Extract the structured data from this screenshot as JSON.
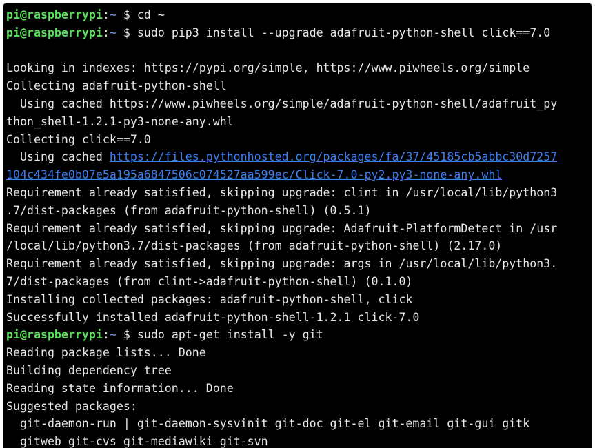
{
  "terminal": {
    "lines": [
      {
        "type": "prompt",
        "user": "pi@raspberrypi",
        "sep": ":",
        "path": "~",
        "symbol": "$",
        "command": "cd ~"
      },
      {
        "type": "prompt",
        "user": "pi@raspberrypi",
        "sep": ":",
        "path": "~",
        "symbol": "$",
        "command": "sudo pip3 install --upgrade adafruit-python-shell click==7.0"
      },
      {
        "type": "output",
        "text": ""
      },
      {
        "type": "output",
        "text": "Looking in indexes: https://pypi.org/simple, https://www.piwheels.org/simple"
      },
      {
        "type": "output",
        "text": "Collecting adafruit-python-shell"
      },
      {
        "type": "output",
        "text": "  Using cached https://www.piwheels.org/simple/adafruit-python-shell/adafruit_py"
      },
      {
        "type": "output",
        "text": "thon_shell-1.2.1-py3-none-any.whl"
      },
      {
        "type": "output",
        "text": "Collecting click==7.0"
      },
      {
        "type": "link",
        "prefix": "  Using cached ",
        "link": "https://files.pythonhosted.org/packages/fa/37/45185cb5abbc30d7257"
      },
      {
        "type": "link",
        "prefix": "",
        "link": "104c434fe0b07e5a195a6847506c074527aa599ec/Click-7.0-py2.py3-none-any.whl"
      },
      {
        "type": "output",
        "text": "Requirement already satisfied, skipping upgrade: clint in /usr/local/lib/python3"
      },
      {
        "type": "output",
        "text": ".7/dist-packages (from adafruit-python-shell) (0.5.1)"
      },
      {
        "type": "output",
        "text": "Requirement already satisfied, skipping upgrade: Adafruit-PlatformDetect in /usr"
      },
      {
        "type": "output",
        "text": "/local/lib/python3.7/dist-packages (from adafruit-python-shell) (2.17.0)"
      },
      {
        "type": "output",
        "text": "Requirement already satisfied, skipping upgrade: args in /usr/local/lib/python3."
      },
      {
        "type": "output",
        "text": "7/dist-packages (from clint->adafruit-python-shell) (0.1.0)"
      },
      {
        "type": "output",
        "text": "Installing collected packages: adafruit-python-shell, click"
      },
      {
        "type": "output",
        "text": "Successfully installed adafruit-python-shell-1.2.1 click-7.0"
      },
      {
        "type": "prompt",
        "user": "pi@raspberrypi",
        "sep": ":",
        "path": "~",
        "symbol": "$",
        "command": "sudo apt-get install -y git"
      },
      {
        "type": "output",
        "text": "Reading package lists... Done"
      },
      {
        "type": "output",
        "text": "Building dependency tree"
      },
      {
        "type": "output",
        "text": "Reading state information... Done"
      },
      {
        "type": "output",
        "text": "Suggested packages:"
      },
      {
        "type": "output",
        "text": "  git-daemon-run | git-daemon-sysvinit git-doc git-el git-email git-gui gitk"
      },
      {
        "type": "output",
        "text": "  gitweb git-cvs git-mediawiki git-svn"
      }
    ]
  },
  "colors": {
    "background": "#000000",
    "text": "#e6e6e6",
    "prompt_user": "#5ce15c",
    "prompt_path": "#6f9cf0",
    "link": "#3e7ef0"
  }
}
